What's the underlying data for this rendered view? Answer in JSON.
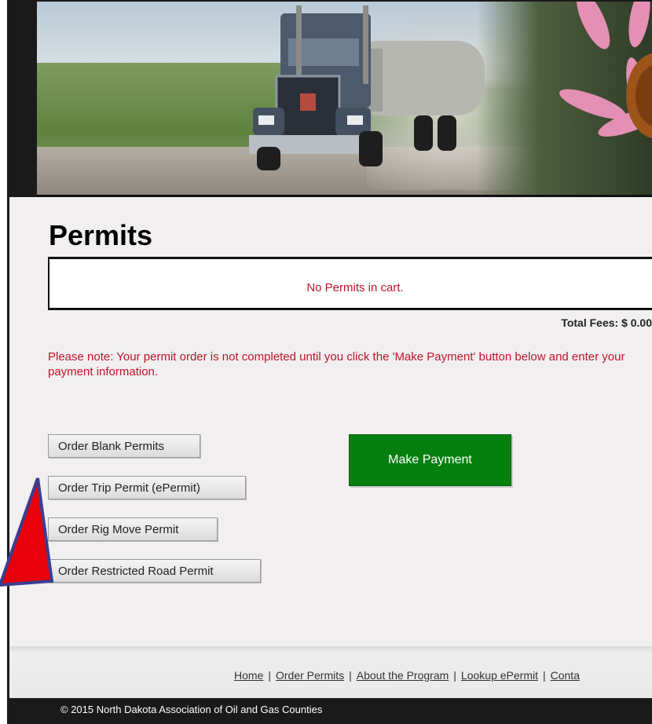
{
  "page": {
    "title": "Permits"
  },
  "cart": {
    "message": "No Permits in cart."
  },
  "fees": {
    "label": "Total Fees: $ 0.00"
  },
  "note": "Please note: Your permit order is not completed until you click the 'Make Payment' button below and enter your payment information.",
  "buttons": {
    "blank": "Order Blank Permits",
    "trip": "Order Trip Permit (ePermit)",
    "rig": "Order Rig Move Permit",
    "restricted": "Order Restricted Road Permit",
    "pay": "Make Payment"
  },
  "footer": {
    "links": [
      "Home",
      "Order Permits",
      "About the Program",
      "Lookup ePermit",
      "Conta"
    ],
    "copyright": "© 2015 North Dakota Association of Oil and Gas Counties"
  },
  "colors": {
    "accent_red": "#c0142b",
    "pay_green": "#05800f",
    "arrow_red": "#e8000b"
  }
}
